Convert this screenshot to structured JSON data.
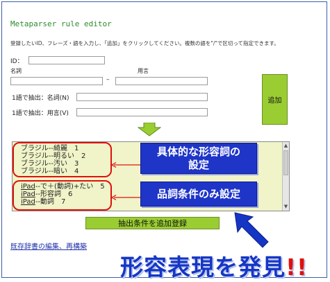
{
  "page": {
    "title": "Metaparser rule editor",
    "description": "登録したいID、フレーズ・語を入力し、「追加」をクリックしてください。複数の語を\"/\"で区切って指定できます。"
  },
  "form": {
    "id_label": "ID：",
    "noun_label": "名詞",
    "verb_label": "用言",
    "dash": "–",
    "extract_noun_label": "1語で抽出：名詞(N)",
    "extract_verb_label": "1語で抽出：用言(V)",
    "add_label": "追加"
  },
  "list": {
    "items_top": [
      "ブラジル--綺麗　1",
      "ブラジル--明るい　2",
      "ブラジル--汚い　3",
      "ブラジル--暗い　4"
    ],
    "items_bottom": [
      {
        "prefix": "iPad",
        "rest": "--で＋(動詞)+たい　5"
      },
      {
        "prefix": "iPad",
        "rest": "--形容詞　6"
      },
      {
        "prefix": "iPad",
        "rest": "--動詞　7"
      }
    ],
    "scroll_up": "▲",
    "scroll_down": "▼"
  },
  "annotations": {
    "top_box_line1": "具体的な形容詞の",
    "top_box_line2": "設定",
    "bottom_box": "品詞条件のみ設定",
    "headline": "形容表現を発見",
    "headline_marks": "!!"
  },
  "actions": {
    "register_label": "抽出条件を追加登録",
    "edit_link": "既存辞書の編集、再構築"
  },
  "colors": {
    "accent_green": "#9acd32",
    "title_green": "#2e8b2e",
    "annotation_blue": "#1f35c8",
    "highlight_red": "#e01010",
    "list_bg": "#f0f4c8"
  }
}
